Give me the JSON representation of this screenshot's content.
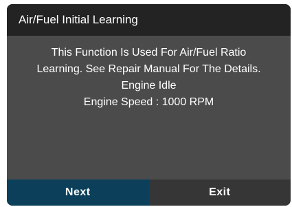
{
  "dialog": {
    "title": "Air/Fuel Initial Learning",
    "message_lines": [
      "This Function Is Used For Air/Fuel Ratio",
      "Learning. See Repair Manual For The Details.",
      "Engine Idle",
      "Engine Speed : 1000 RPM"
    ],
    "buttons": {
      "next_label": "Next",
      "exit_label": "Exit"
    }
  },
  "colors": {
    "title_bar": "#232323",
    "body": "#4b4b4b",
    "next_button": "#0b3f5a",
    "exit_button": "#363636",
    "text": "#ffffff"
  }
}
